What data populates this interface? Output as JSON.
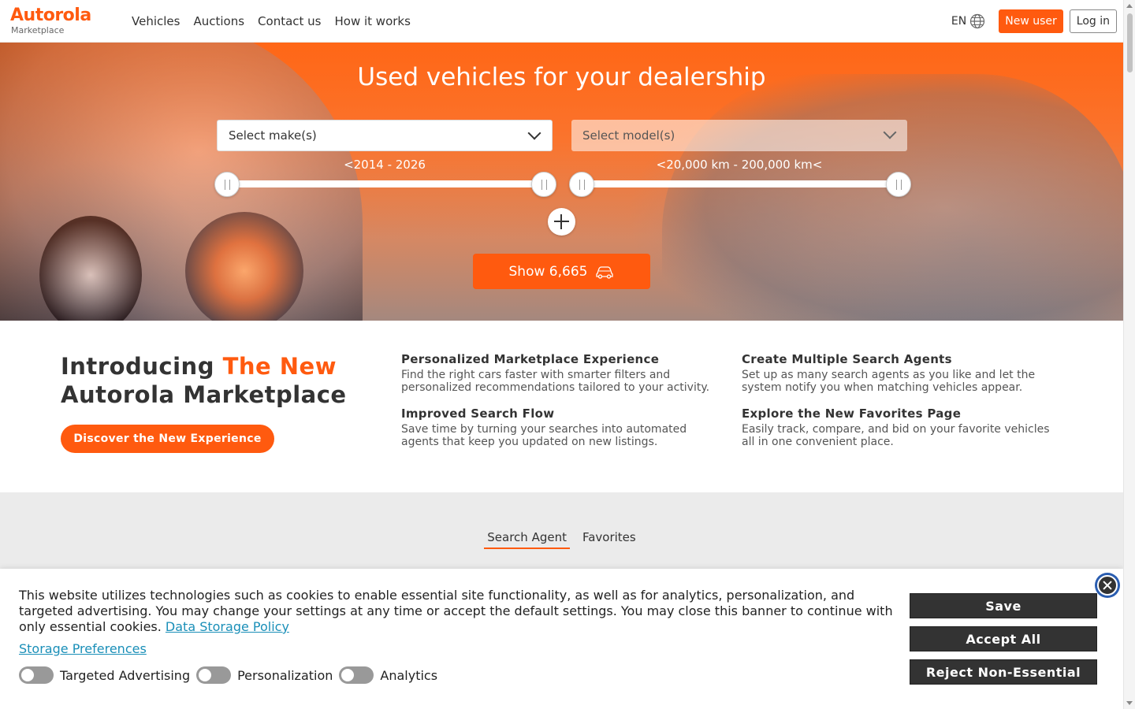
{
  "header": {
    "logo": "Autorola",
    "logo_sub": "Marketplace",
    "nav": [
      "Vehicles",
      "Auctions",
      "Contact us",
      "How it works"
    ],
    "lang": "EN",
    "new_user": "New user",
    "login": "Log in"
  },
  "hero": {
    "title": "Used vehicles for your dealership",
    "make_placeholder": "Select make(s)",
    "model_placeholder": "Select model(s)",
    "year_range": "<2014 - 2026",
    "km_range": "<20,000 km - 200,000 km<",
    "show_button": "Show 6,665"
  },
  "intro": {
    "title_part1": "Introducing ",
    "title_highlight": "The New",
    "title_part2": "Autorola Marketplace",
    "discover_button": "Discover the New Experience",
    "features": [
      {
        "title": "Personalized Marketplace Experience",
        "text": "Find the right cars faster with smarter filters and personalized recommendations tailored to your activity."
      },
      {
        "title": "Create Multiple Search Agents",
        "text": "Set up as many search agents as you like and let the system notify you when matching vehicles appear."
      },
      {
        "title": "Improved Search Flow",
        "text": "Save time by turning your searches into automated agents that keep you updated on new listings."
      },
      {
        "title": "Explore the New Favorites Page",
        "text": "Easily track, compare, and bid on your favorite vehicles all in one convenient place."
      }
    ]
  },
  "tabs": [
    "Search Agent",
    "Favorites"
  ],
  "cookie": {
    "text": "This website utilizes technologies such as cookies to enable essential site functionality, as well as for analytics, personalization, and targeted advertising. You may change your settings at any time or accept the default settings. You may close this banner to continue with only essential cookies. ",
    "policy_link": "Data Storage Policy",
    "preferences_link": "Storage Preferences",
    "toggles": [
      "Targeted Advertising",
      "Personalization",
      "Analytics"
    ],
    "save": "Save",
    "accept_all": "Accept All",
    "reject": "Reject Non-Essential"
  },
  "colors": {
    "accent": "#ff5a0f",
    "link": "#1a8fb8",
    "dark_button": "#333333"
  }
}
